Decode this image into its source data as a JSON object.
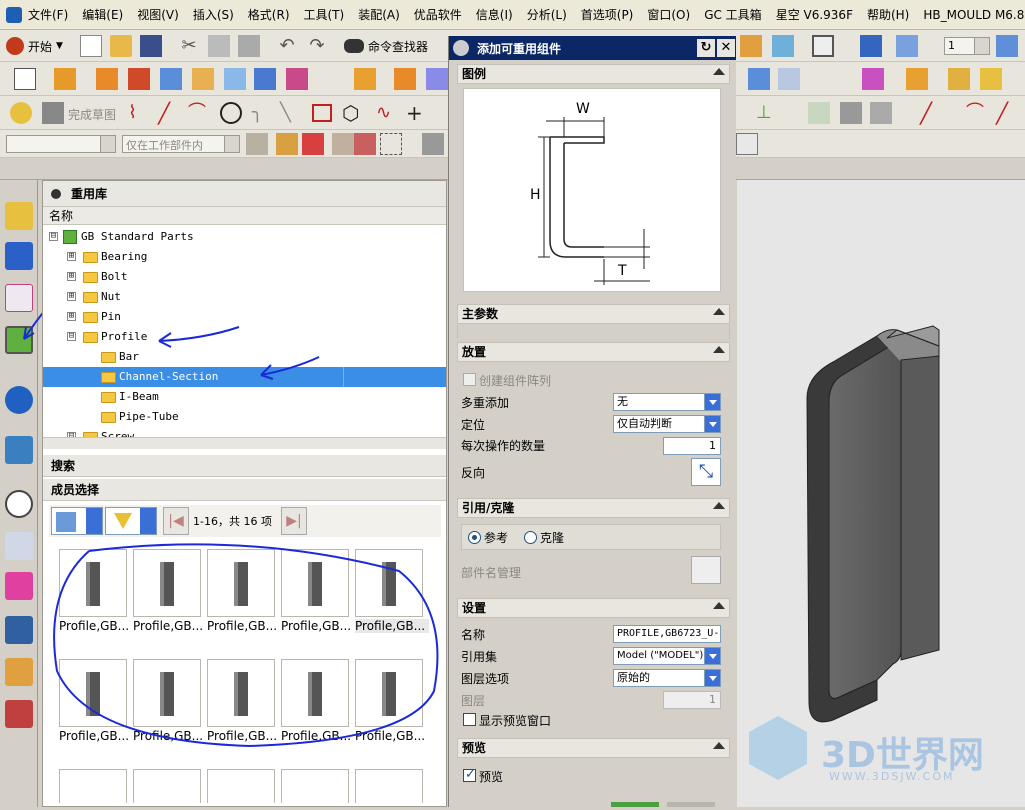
{
  "menubar": {
    "items": [
      "文件(F)",
      "编辑(E)",
      "视图(V)",
      "插入(S)",
      "格式(R)",
      "工具(T)",
      "装配(A)",
      "优品软件",
      "信息(I)",
      "分析(L)",
      "首选项(P)",
      "窗口(O)",
      "GC 工具箱",
      "星空 V6.936F",
      "帮助(H)",
      "HB_MOULD M6.8"
    ]
  },
  "toolbar": {
    "start_label": "开始",
    "cmd_finder": "命令查找器",
    "finish_sketch": "完成草图",
    "filter_combo": "仅在工作部件内",
    "layer_value": "1"
  },
  "library": {
    "title": "重用库",
    "column_header": "名称",
    "tree": [
      {
        "label": "GB Standard Parts",
        "exp": "⊟",
        "selected": false
      },
      {
        "label": "Bearing",
        "exp": "⊞",
        "selected": false
      },
      {
        "label": "Bolt",
        "exp": "⊞",
        "selected": false
      },
      {
        "label": "Nut",
        "exp": "⊞",
        "selected": false
      },
      {
        "label": "Pin",
        "exp": "⊞",
        "selected": false
      },
      {
        "label": "Profile",
        "exp": "⊟",
        "selected": false
      },
      {
        "label": "Bar",
        "exp": "",
        "selected": false
      },
      {
        "label": "Channel-Section",
        "exp": "",
        "selected": true
      },
      {
        "label": "I-Beam",
        "exp": "",
        "selected": false
      },
      {
        "label": "Pipe-Tube",
        "exp": "",
        "selected": false
      },
      {
        "label": "Screw",
        "exp": "⊟",
        "selected": false
      }
    ],
    "search_label": "搜索",
    "member_label": "成员选择",
    "page_info": "1-16，共 16 项",
    "members": [
      "Profile,GB...",
      "Profile,GB...",
      "Profile,GB...",
      "Profile,GB...",
      "Profile,GB...",
      "Profile,GB...",
      "Profile,GB...",
      "Profile,GB...",
      "Profile,GB...",
      "Profile,GB..."
    ]
  },
  "dialog": {
    "title": "添加可重用组件",
    "legend_label": "图例",
    "dim_w": "W",
    "dim_h": "H",
    "dim_t": "T",
    "main_params_label": "主参数",
    "place_label": "放置",
    "create_array": "创建组件阵列",
    "multi_add_label": "多重添加",
    "multi_add_value": "无",
    "position_label": "定位",
    "position_value": "仅自动判断",
    "qty_label": "每次操作的数量",
    "qty_value": "1",
    "reverse_label": "反向",
    "ref_clone_label": "引用/克隆",
    "ref_option": "参考",
    "clone_option": "克隆",
    "part_name_mgmt": "部件名管理",
    "settings_label": "设置",
    "name_label": "名称",
    "name_value": "PROFILE,GB6723_U-",
    "refset_label": "引用集",
    "refset_value": "Model (\"MODEL\")",
    "layer_opt_label": "图层选项",
    "layer_opt_value": "原始的",
    "layer_label": "图层",
    "layer_value": "1",
    "show_preview": "显示预览窗口",
    "preview_section": "预览",
    "preview_chk": "预览"
  },
  "watermark": {
    "brand": "3D世界网",
    "url": "WWW.3DSJW.COM"
  }
}
